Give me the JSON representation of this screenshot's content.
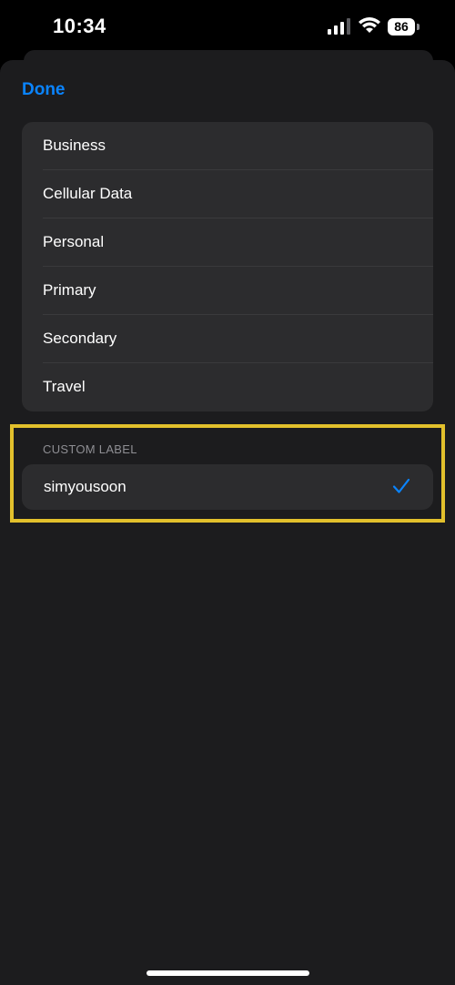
{
  "status_bar": {
    "time": "10:34",
    "battery_level": "86",
    "icons": [
      "cellular-signal-icon",
      "wifi-icon",
      "battery-icon"
    ]
  },
  "header": {
    "done_label": "Done"
  },
  "labels": {
    "items": [
      {
        "label": "Business"
      },
      {
        "label": "Cellular Data"
      },
      {
        "label": "Personal"
      },
      {
        "label": "Primary"
      },
      {
        "label": "Secondary"
      },
      {
        "label": "Travel"
      }
    ]
  },
  "custom_label": {
    "section_title": "CUSTOM LABEL",
    "value": "simyousoon",
    "selected": true
  },
  "colors": {
    "accent": "#0a84ff",
    "highlight": "#e2c02c",
    "background": "#1c1c1e",
    "cell": "#2c2c2e"
  }
}
